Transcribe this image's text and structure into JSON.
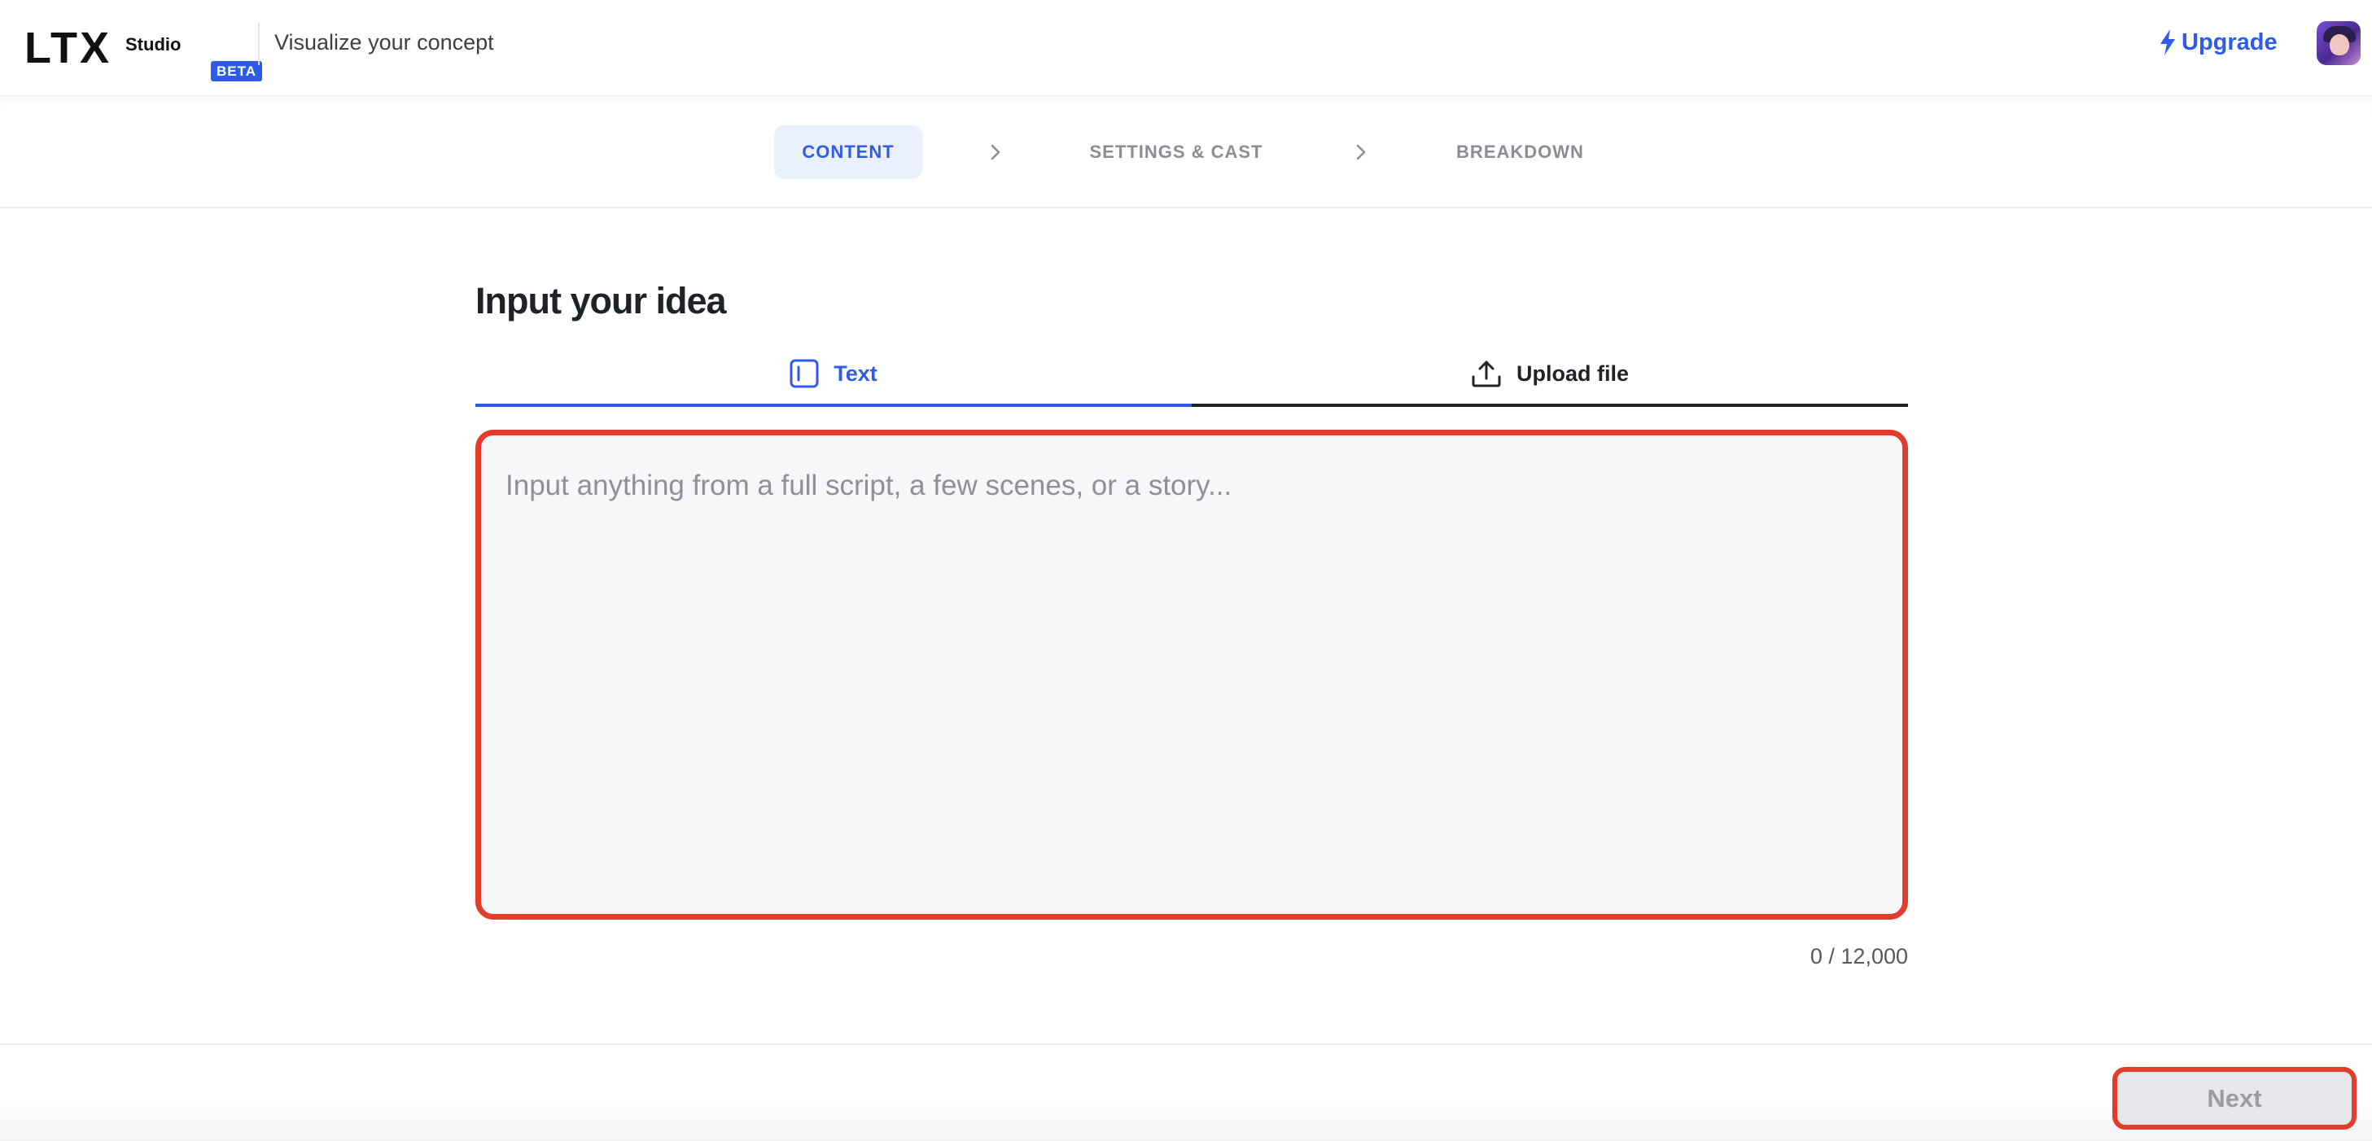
{
  "app": {
    "logo_text": "LTX",
    "logo_sub": "Studio",
    "badge": "BETA",
    "page_title": "Visualize your concept",
    "upgrade_label": "Upgrade",
    "upgrade_icon": "lightning-bolt-icon",
    "accent_color": "#2f5bea"
  },
  "stepper": {
    "steps": [
      {
        "label": "CONTENT",
        "active": true
      },
      {
        "label": "SETTINGS & CAST",
        "active": false
      },
      {
        "label": "BREAKDOWN",
        "active": false
      }
    ],
    "separator_icon": "chevron-right-icon"
  },
  "main": {
    "title": "Input your idea",
    "tabs": [
      {
        "label": "Text",
        "icon": "text-cursor-icon",
        "active": true
      },
      {
        "label": "Upload file",
        "icon": "upload-icon",
        "active": false
      }
    ],
    "textarea": {
      "placeholder": "Input anything from a full script, a few scenes, or a story...",
      "value": ""
    },
    "char_count": "0 / 12,000"
  },
  "footer": {
    "next_label": "Next"
  }
}
